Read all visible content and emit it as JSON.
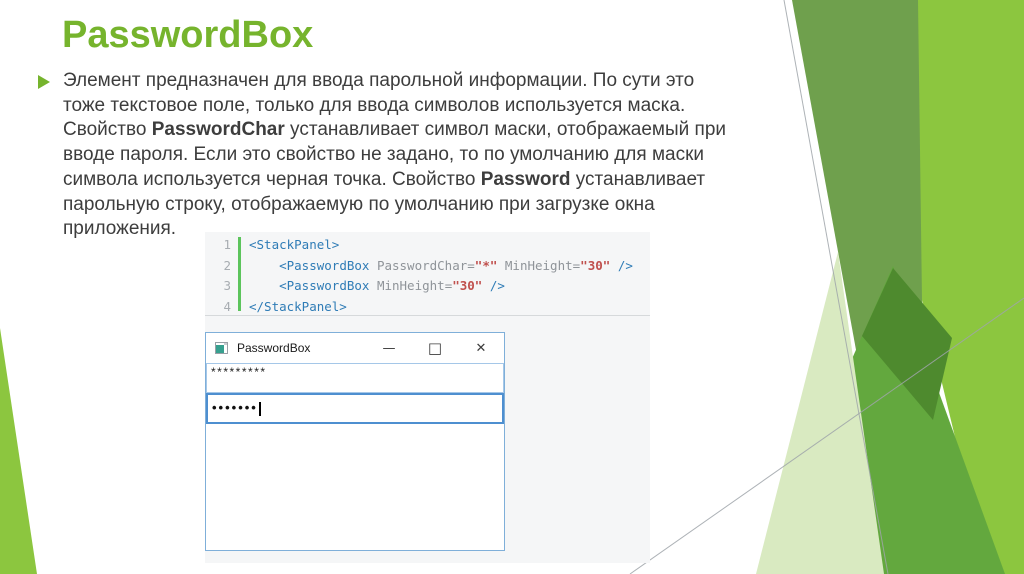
{
  "slide": {
    "title": "PasswordBox",
    "bullet": {
      "lines": [
        [
          {
            "t": "Элемент предназначен для ввода парольной информации. По сути это"
          }
        ],
        [
          {
            "t": "тоже текстовое поле, только для ввода символов используется маска."
          }
        ],
        [
          {
            "t": "Свойство "
          },
          {
            "t": "PasswordChar",
            "b": true
          },
          {
            "t": " устанавливает символ маски, отображаемый при"
          }
        ],
        [
          {
            "t": "вводе пароля. Если это свойство не задано, то по умолчанию для маски"
          }
        ],
        [
          {
            "t": "символа используется черная точка. Свойство "
          },
          {
            "t": "Password",
            "b": true
          },
          {
            "t": " устанавливает"
          }
        ],
        [
          {
            "t": "парольную строку, отображаемую по умолчанию при загрузке окна"
          }
        ],
        [
          {
            "t": "приложения."
          }
        ]
      ]
    }
  },
  "code": {
    "lines": [
      {
        "no": "1",
        "tokens": [
          {
            "t": "<StackPanel>",
            "c": "tag"
          }
        ]
      },
      {
        "no": "2",
        "tokens": [
          {
            "t": "    ",
            "c": "plain"
          },
          {
            "t": "<PasswordBox",
            "c": "tag"
          },
          {
            "t": " ",
            "c": "plain"
          },
          {
            "t": "PasswordChar",
            "c": "attr"
          },
          {
            "t": "=",
            "c": "punct"
          },
          {
            "t": "\"*\"",
            "c": "val"
          },
          {
            "t": " ",
            "c": "plain"
          },
          {
            "t": "MinHeight",
            "c": "attr"
          },
          {
            "t": "=",
            "c": "punct"
          },
          {
            "t": "\"30\"",
            "c": "val"
          },
          {
            "t": " ",
            "c": "plain"
          },
          {
            "t": "/>",
            "c": "tag"
          }
        ]
      },
      {
        "no": "3",
        "tokens": [
          {
            "t": "    ",
            "c": "plain"
          },
          {
            "t": "<PasswordBox",
            "c": "tag"
          },
          {
            "t": " ",
            "c": "plain"
          },
          {
            "t": "MinHeight",
            "c": "attr"
          },
          {
            "t": "=",
            "c": "punct"
          },
          {
            "t": "\"30\"",
            "c": "val"
          },
          {
            "t": " ",
            "c": "plain"
          },
          {
            "t": "/>",
            "c": "tag"
          }
        ]
      },
      {
        "no": "4",
        "tokens": [
          {
            "t": "</StackPanel>",
            "c": "tag"
          }
        ]
      }
    ]
  },
  "window": {
    "title": "PasswordBox",
    "controls": {
      "minimize": "—",
      "maximize": "□",
      "close": "✕"
    },
    "field1_text": "*********",
    "field2_text": "•••••••"
  },
  "colors": {
    "accent_green": "#76B42D",
    "bright_green": "#8CC63F",
    "sage_green": "#6FA04D",
    "medium_green": "#63A83E",
    "dark_green": "#4E8A2E",
    "pale_green": "#D9EAC1",
    "body_text": "#3d3d3d",
    "code_tag": "#2F7CB6",
    "code_attr": "#8F9499",
    "code_value": "#C0504D",
    "window_border_blue": "#7FAFD9",
    "focused_field_blue": "#4E8FD0"
  }
}
